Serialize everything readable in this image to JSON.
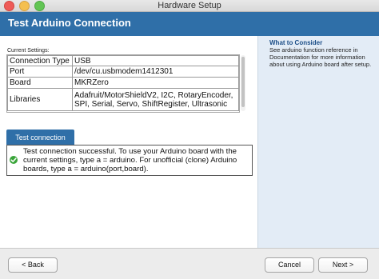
{
  "window": {
    "title": "Hardware Setup"
  },
  "header": {
    "title": "Test Arduino Connection"
  },
  "sidebar": {
    "heading": "What to Consider",
    "text": "See arduino function reference in Documentation for more information about using Arduino board after setup."
  },
  "settings": {
    "label": "Current Settings:",
    "rows": [
      {
        "key": "Connection Type",
        "value": "USB"
      },
      {
        "key": "Port",
        "value": "/dev/cu.usbmodem1412301"
      },
      {
        "key": "Board",
        "value": "MKRZero"
      },
      {
        "key": "Libraries",
        "value": "Adafruit/MotorShieldV2, I2C, RotaryEncoder, SPI, Serial, Servo, ShiftRegister, Ultrasonic"
      }
    ]
  },
  "test": {
    "button_label": "Test connection",
    "result_message": "Test connection successful. To use your Arduino board with the current settings, type a = arduino. For unofficial (clone) Arduino boards, type a = arduino(port,board)."
  },
  "footer": {
    "back_label": "< Back",
    "cancel_label": "Cancel",
    "next_label": "Next >"
  }
}
